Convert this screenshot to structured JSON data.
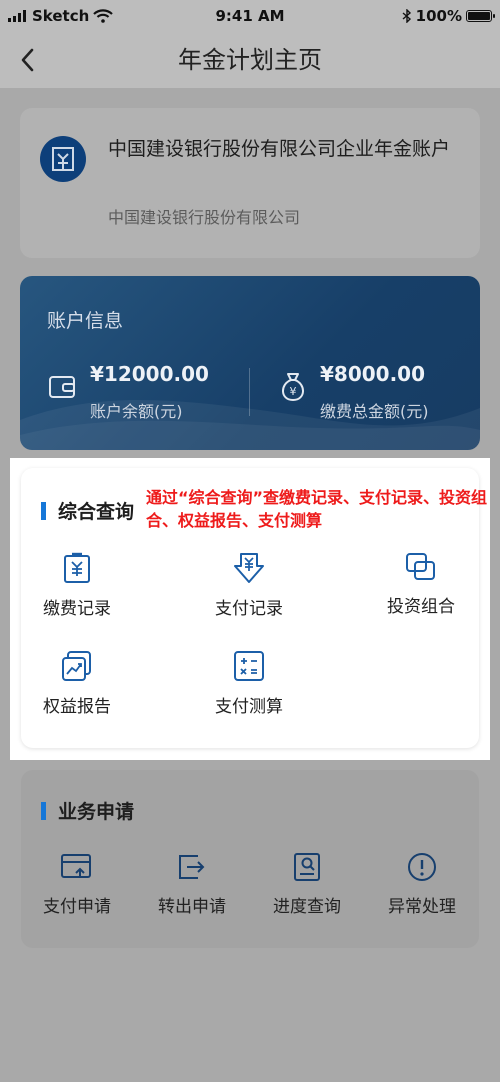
{
  "status_bar": {
    "carrier": "Sketch",
    "time": "9:41 AM",
    "battery": "100%"
  },
  "nav": {
    "title": "年金计划主页"
  },
  "account": {
    "name": "中国建设银行股份有限公司企业年金账户",
    "sub": "中国建设银行股份有限公司"
  },
  "info": {
    "title": "账户信息",
    "balance_amount": "¥12000.00",
    "balance_label": "账户余额(元)",
    "paid_amount": "¥8000.00",
    "paid_label": "缴费总金额(元)"
  },
  "query": {
    "title": "综合查询",
    "annotation": "通过“综合查询”查缴费记录、支付记录、投资组合、权益报告、支付测算",
    "items": [
      {
        "label": "缴费记录",
        "icon": "payment-record-icon"
      },
      {
        "label": "支付记录",
        "icon": "withdrawal-record-icon"
      },
      {
        "label": "投资组合",
        "icon": "portfolio-icon"
      },
      {
        "label": "权益报告",
        "icon": "equity-report-icon"
      },
      {
        "label": "支付测算",
        "icon": "calculator-icon"
      }
    ]
  },
  "business": {
    "title": "业务申请",
    "items": [
      {
        "label": "支付申请",
        "icon": "payment-apply-icon"
      },
      {
        "label": "转出申请",
        "icon": "transfer-out-icon"
      },
      {
        "label": "进度查询",
        "icon": "progress-query-icon"
      },
      {
        "label": "异常处理",
        "icon": "exception-icon"
      }
    ]
  },
  "colors": {
    "accent": "#1677d8",
    "annotation": "#ee1b1b",
    "bank_blue": "#0d3f7a"
  }
}
